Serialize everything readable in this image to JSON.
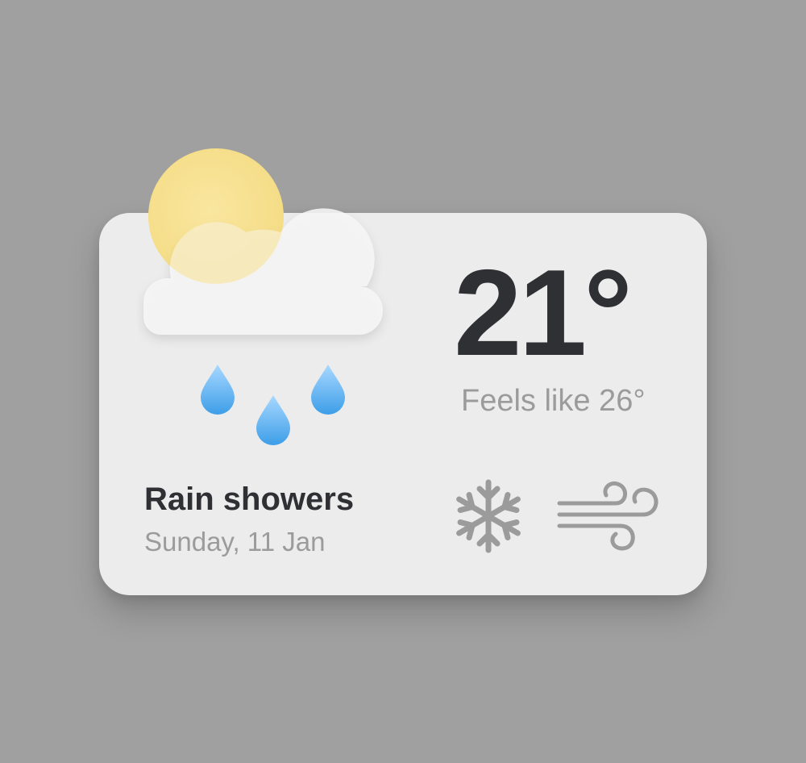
{
  "weather": {
    "temperature": "21°",
    "feels_like": "Feels like 26°",
    "condition": "Rain showers",
    "date": "Sunday, 11 Jan"
  },
  "icons": {
    "main": "sun-cloud-rain-icon",
    "secondary": [
      "snowflake-icon",
      "wind-icon"
    ]
  },
  "colors": {
    "background": "#a0a0a0",
    "card": "#ececec",
    "sun": "#f3d96a",
    "cloud": "#f6f6f6",
    "raindrop": "#4aa6ea",
    "primary_text": "#2f3033",
    "secondary_text": "#9b9b9b",
    "icon": "#9b9b9b"
  }
}
